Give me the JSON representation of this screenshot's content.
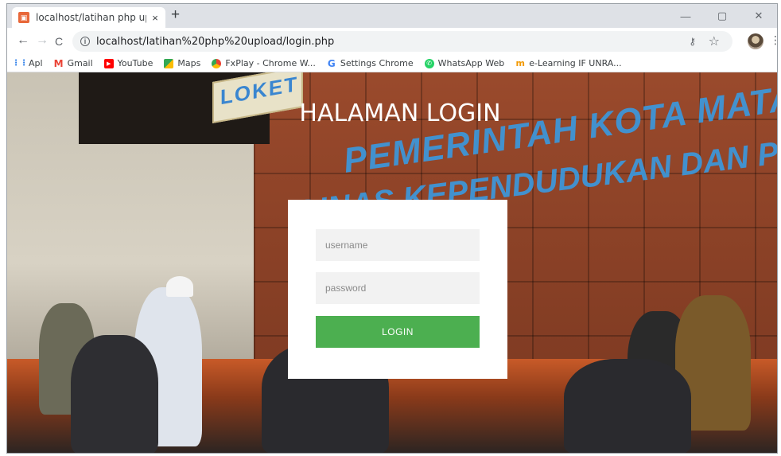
{
  "browser": {
    "tab": {
      "title": "localhost/latihan php upload/log",
      "close_label": "×"
    },
    "new_tab_label": "+",
    "window_controls": {
      "minimize": "—",
      "maximize": "▢",
      "close": "✕"
    },
    "nav": {
      "back": "←",
      "forward": "→",
      "reload": "C"
    },
    "address_bar": {
      "url": "localhost/latihan%20php%20upload/login.php"
    },
    "bookmarks": [
      {
        "label": "Apl",
        "icon": "apps-grid-icon",
        "color": "#1a73e8"
      },
      {
        "label": "Gmail",
        "icon": "gmail-icon",
        "color": "#ea4335"
      },
      {
        "label": "YouTube",
        "icon": "youtube-icon",
        "color": "#ff0000"
      },
      {
        "label": "Maps",
        "icon": "maps-icon",
        "color": "#34a853"
      },
      {
        "label": "FxPlay - Chrome W...",
        "icon": "chrome-icon",
        "color": "#4285f4"
      },
      {
        "label": "Settings Chrome",
        "icon": "google-icon",
        "color": "#4285f4"
      },
      {
        "label": "WhatsApp Web",
        "icon": "whatsapp-icon",
        "color": "#25d366"
      },
      {
        "label": "e-Learning IF UNRA...",
        "icon": "elearning-icon",
        "color": "#f29900"
      }
    ]
  },
  "background": {
    "loket_sign": "LOKET",
    "wall_text_1": "PEMERINTAH KOTA MATARAM",
    "wall_text_2": "DINAS KEPENDUDUKAN DAN PENCATATAN S"
  },
  "page": {
    "heading": "HALAMAN LOGIN",
    "form": {
      "username_placeholder": "username",
      "password_placeholder": "password",
      "login_label": "LOGIN"
    }
  },
  "colors": {
    "login_button": "#4caf50",
    "input_bg": "#f2f2f2",
    "card_bg": "#ffffff"
  }
}
